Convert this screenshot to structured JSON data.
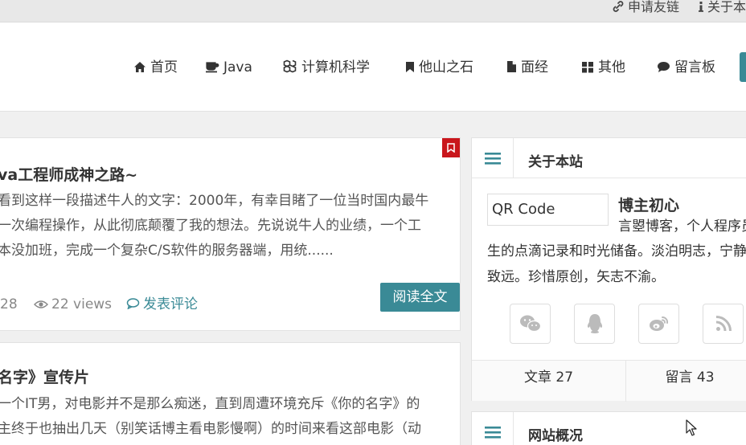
{
  "topbar": {
    "links": [
      {
        "label": "申请友链",
        "icon": "link-icon"
      },
      {
        "label": "关于本",
        "icon": "info-icon"
      }
    ]
  },
  "nav": {
    "items": [
      {
        "label": "首页",
        "icon": "home-icon"
      },
      {
        "label": "Java",
        "icon": "coffee-icon"
      },
      {
        "label": "计算机科学",
        "icon": "cubes-icon"
      },
      {
        "label": "他山之石",
        "icon": "bookmark-icon"
      },
      {
        "label": "面经",
        "icon": "file-icon"
      },
      {
        "label": "其他",
        "icon": "grid-icon"
      },
      {
        "label": "留言板",
        "icon": "comment-icon"
      }
    ]
  },
  "posts": [
    {
      "title": "va工程师成神之路~",
      "excerpt": [
        "看到这样一段描述牛人的文字：2000年，有幸目睹了一位当时国内最牛",
        "一次编程操作，从此彻底颠覆了我的想法。先说说牛人的业绩，一个工",
        "本没加班，完成一个复杂C/S软件的服务器端，用统......"
      ],
      "date_fragment": "28",
      "views": "22 views",
      "comment_link": "发表评论",
      "read_more": "阅读全文"
    },
    {
      "title": "名字》宣传片",
      "excerpt": [
        "一个IT男，对电影并不是那么痴迷，直到周遭环境充斥《你的名字》的",
        "主终于也抽出几天（别笑话博主看电影慢啊）的时间来看这部电影（动"
      ]
    }
  ],
  "about_widget": {
    "title": "关于本站",
    "qr_text": "QR Code",
    "owner_name": "博主初心",
    "lines": [
      "言曌博客，个人程序员",
      "生的点滴记录和时光储备。淡泊明志，宁静",
      "致远。珍惜原创，矢志不渝。"
    ],
    "social": [
      "wechat-icon",
      "qq-icon",
      "weibo-icon",
      "rss-icon"
    ],
    "stats": [
      {
        "label": "文章",
        "value": "27"
      },
      {
        "label": "留言",
        "value": "43"
      }
    ]
  },
  "overview_widget": {
    "title": "网站概况"
  },
  "colors": {
    "accent": "#3a8a96",
    "bookmark": "#c9161c"
  }
}
